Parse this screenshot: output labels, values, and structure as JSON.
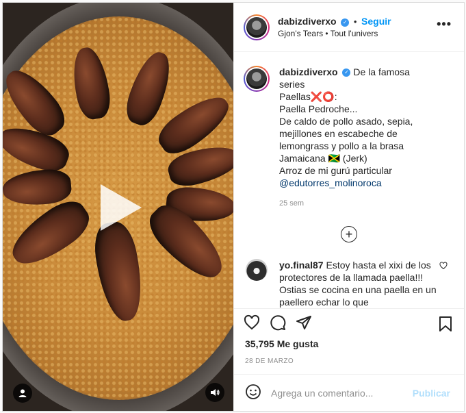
{
  "post": {
    "author": {
      "username": "dabizdiverxo",
      "follow_label": "Seguir",
      "audio_line": "Gjon's Tears • Tout l'univers"
    },
    "caption": {
      "username": "dabizdiverxo",
      "lines": [
        "De la famosa series",
        "Paellas❌⭕:",
        "Paella Pedroche...",
        "De caldo de pollo asado, sepia,",
        "mejillones en escabeche de",
        "lemongrass y pollo a la brasa",
        "Jamaicana 🇯🇲 (Jerk)",
        "Arroz de mi gurú particular"
      ],
      "mention": "@edutorres_molinoroca",
      "age": "25 sem"
    },
    "comments": [
      {
        "username": "yo.final87",
        "text": "Estoy hasta el xixi de los protectores de la llamada paella!!! Ostias se cocina en una paella en un paellero echar lo que"
      }
    ],
    "likes": "35,795 Me gusta",
    "date": "28 DE MARZO",
    "comment_input": {
      "placeholder": "Agrega un comentario...",
      "publish_label": "Publicar"
    },
    "icons": {
      "verified": "verified-badge-icon",
      "more": "more-options-icon",
      "load_more": "plus-circle-icon",
      "like": "heart-icon",
      "comment": "comment-icon",
      "share": "paper-plane-icon",
      "save": "bookmark-icon",
      "emoji": "emoji-icon",
      "play": "play-icon",
      "user_tag": "user-icon",
      "audio": "speaker-icon"
    },
    "colors": {
      "accent": "#0095f6",
      "publish_disabled": "#b2dffc",
      "muted": "#8e8e8e"
    }
  }
}
